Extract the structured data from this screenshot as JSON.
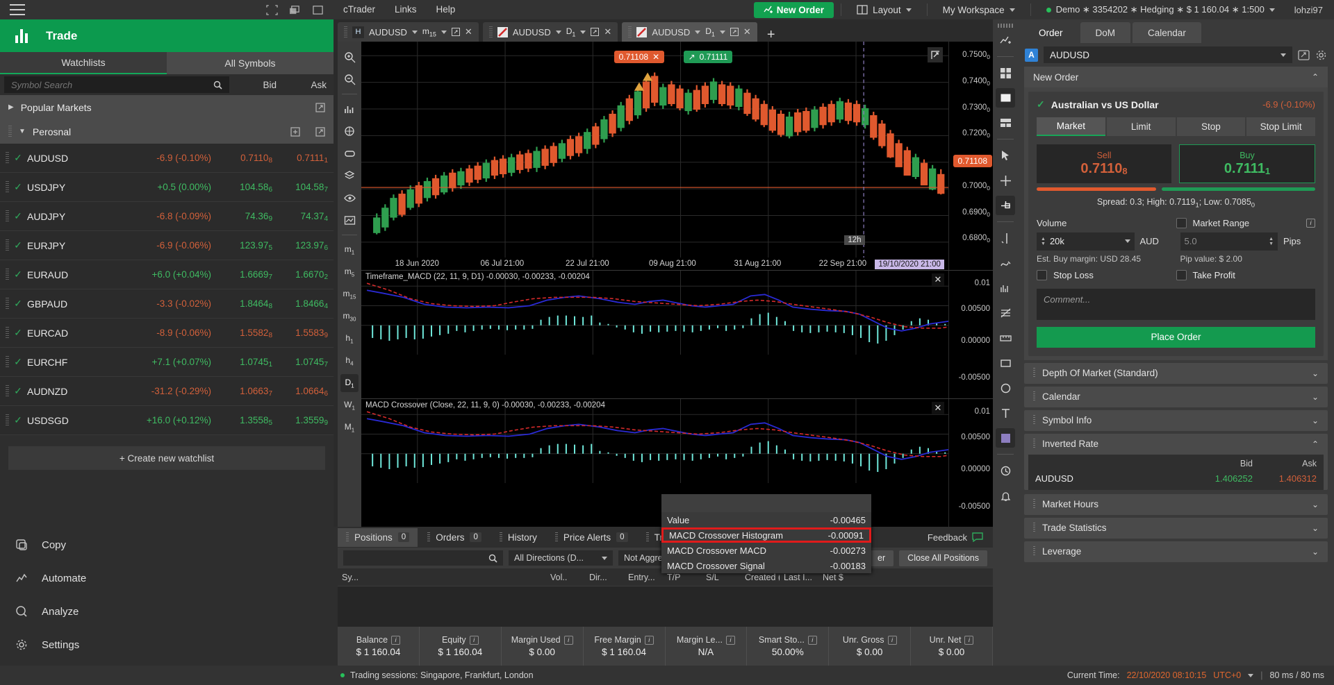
{
  "topbar": {
    "menus": [
      "cTrader",
      "Links",
      "Help"
    ],
    "new_order": "New Order",
    "layout": "Layout",
    "workspace": "My Workspace",
    "account": "Demo ∗ 3354202 ∗ Hedging ∗ $ 1 160.04 ∗ 1:500",
    "user": "lohzi97"
  },
  "sidebar": {
    "title": "Trade",
    "tabs": [
      {
        "label": "Watchlists",
        "active": true
      },
      {
        "label": "All Symbols",
        "active": false
      }
    ],
    "search_placeholder": "Symbol Search",
    "col_bid": "Bid",
    "col_ask": "Ask",
    "groups": [
      {
        "name": "Popular Markets",
        "expanded": false
      },
      {
        "name": "Perosnal",
        "expanded": true
      }
    ],
    "symbols": [
      {
        "name": "AUDUSD",
        "change": "-6.9 (-0.10%)",
        "dir": "down",
        "bid": "0.7110",
        "bid_sub": "8",
        "bid_dir": "down",
        "ask": "0.7111",
        "ask_sub": "1",
        "ask_dir": "down"
      },
      {
        "name": "USDJPY",
        "change": "+0.5 (0.00%)",
        "dir": "up",
        "bid": "104.58",
        "bid_sub": "6",
        "bid_dir": "up",
        "ask": "104.58",
        "ask_sub": "7",
        "ask_dir": "up"
      },
      {
        "name": "AUDJPY",
        "change": "-6.8 (-0.09%)",
        "dir": "down",
        "bid": "74.36",
        "bid_sub": "9",
        "bid_dir": "up",
        "ask": "74.37",
        "ask_sub": "4",
        "ask_dir": "up"
      },
      {
        "name": "EURJPY",
        "change": "-6.9 (-0.06%)",
        "dir": "down",
        "bid": "123.97",
        "bid_sub": "5",
        "bid_dir": "up",
        "ask": "123.97",
        "ask_sub": "6",
        "ask_dir": "up"
      },
      {
        "name": "EURAUD",
        "change": "+6.0 (+0.04%)",
        "dir": "up",
        "bid": "1.6669",
        "bid_sub": "7",
        "bid_dir": "up",
        "ask": "1.6670",
        "ask_sub": "2",
        "ask_dir": "up"
      },
      {
        "name": "GBPAUD",
        "change": "-3.3 (-0.02%)",
        "dir": "down",
        "bid": "1.8464",
        "bid_sub": "8",
        "bid_dir": "up",
        "ask": "1.8466",
        "ask_sub": "4",
        "ask_dir": "up"
      },
      {
        "name": "EURCAD",
        "change": "-8.9 (-0.06%)",
        "dir": "down",
        "bid": "1.5582",
        "bid_sub": "8",
        "bid_dir": "down",
        "ask": "1.5583",
        "ask_sub": "9",
        "ask_dir": "down"
      },
      {
        "name": "EURCHF",
        "change": "+7.1 (+0.07%)",
        "dir": "up",
        "bid": "1.0745",
        "bid_sub": "1",
        "bid_dir": "up",
        "ask": "1.0745",
        "ask_sub": "7",
        "ask_dir": "up"
      },
      {
        "name": "AUDNZD",
        "change": "-31.2 (-0.29%)",
        "dir": "down",
        "bid": "1.0663",
        "bid_sub": "7",
        "bid_dir": "down",
        "ask": "1.0664",
        "ask_sub": "6",
        "ask_dir": "down"
      },
      {
        "name": "USDSGD",
        "change": "+16.0 (+0.12%)",
        "dir": "up",
        "bid": "1.3558",
        "bid_sub": "5",
        "bid_dir": "up",
        "ask": "1.3559",
        "ask_sub": "9",
        "ask_dir": "up"
      }
    ],
    "create_watchlist": "+ Create new watchlist",
    "nav": [
      {
        "label": "Copy",
        "icon": "copy-icon"
      },
      {
        "label": "Automate",
        "icon": "automate-icon"
      },
      {
        "label": "Analyze",
        "icon": "analyze-icon"
      },
      {
        "label": "Settings",
        "icon": "gear-icon"
      }
    ]
  },
  "chart_tabs": [
    {
      "symbol": "AUDUSD",
      "tf": "m",
      "tf_sub": "15",
      "badge": "H",
      "active": false
    },
    {
      "symbol": "AUDUSD",
      "tf": "D",
      "tf_sub": "1",
      "badge": "line",
      "active": false
    },
    {
      "symbol": "AUDUSD",
      "tf": "D",
      "tf_sub": "1",
      "badge": "line",
      "active": true
    }
  ],
  "chart_data": {
    "type": "line",
    "title": "AUDUSD D1",
    "price_axis_ticks": [
      "0.7500",
      "0.7400",
      "0.7300",
      "0.7200",
      "0.7100",
      "0.7000",
      "0.6900",
      "0.6800"
    ],
    "price_axis_sub": [
      "0",
      "0",
      "0",
      "0",
      "8",
      "0",
      "0",
      "0"
    ],
    "x_ticks": [
      "18 Jun 2020",
      "06 Jul 21:00",
      "22 Jul 21:00",
      "09 Aug 21:00",
      "31 Aug 21:00",
      "22 Sep 21:00"
    ],
    "current_price_tag": "0.71108",
    "cursor_tag": "19/10/2020 21:00",
    "cursor_bar_label": "12h",
    "bid_tag": "0.71108",
    "ask_tag": "0.71111",
    "macd_panes": [
      {
        "label": "Timeframe_MACD (22, 11, 9, D1) -0.00030, -0.00233, -0.00204",
        "ticks": [
          "0.01",
          "0.00500",
          "0.00000",
          "-0.00500"
        ]
      },
      {
        "label": "MACD Crossover (Close, 22, 11, 9, 0) -0.00030, -0.00233, -0.00204",
        "ticks": [
          "0.01",
          "0.00500",
          "0.00000",
          "-0.00500"
        ]
      }
    ]
  },
  "tooltip": {
    "rows": [
      {
        "label": "Value",
        "value": "-0.00465",
        "highlight": false
      },
      {
        "label": "MACD Crossover Histogram",
        "value": "-0.00091",
        "highlight": true
      },
      {
        "label": "MACD Crossover MACD",
        "value": "-0.00273",
        "highlight": false
      },
      {
        "label": "MACD Crossover Signal",
        "value": "-0.00183",
        "highlight": false
      }
    ]
  },
  "bottom": {
    "tabs": [
      {
        "label": "Positions",
        "count": "0",
        "active": true
      },
      {
        "label": "Orders",
        "count": "0",
        "active": false
      },
      {
        "label": "History",
        "count": "",
        "active": false
      },
      {
        "label": "Price Alerts",
        "count": "0",
        "active": false
      },
      {
        "label": "Trans",
        "count": "",
        "active": false
      }
    ],
    "feedback": "Feedback",
    "filter_directions": "All Directions (D...",
    "filter_aggregation": "Not Aggreg",
    "btn_partial": "er",
    "btn_close_all": "Close All Positions",
    "columns": [
      "Sy...",
      "Vol..",
      "Dir...",
      "Entry...",
      "T/P",
      "S/L",
      "Created (...",
      "Last I...",
      "Net $"
    ]
  },
  "metrics": [
    {
      "label": "Balance",
      "value": "$ 1 160.04"
    },
    {
      "label": "Equity",
      "value": "$ 1 160.04"
    },
    {
      "label": "Margin Used",
      "value": "$ 0.00"
    },
    {
      "label": "Free Margin",
      "value": "$ 1 160.04"
    },
    {
      "label": "Margin Le...",
      "value": "N/A"
    },
    {
      "label": "Smart Sto...",
      "value": "50.00%"
    },
    {
      "label": "Unr. Gross",
      "value": "$ 0.00"
    },
    {
      "label": "Unr. Net",
      "value": "$ 0.00"
    }
  ],
  "right": {
    "tabs": [
      {
        "label": "Order",
        "active": true
      },
      {
        "label": "DoM",
        "active": false
      },
      {
        "label": "Calendar",
        "active": false
      }
    ],
    "symbol": "AUDUSD",
    "symbol_badge": "A",
    "new_order_header": "New Order",
    "instrument": "Australian vs US Dollar",
    "instrument_change": "-6.9 (-0.10%)",
    "order_types": [
      {
        "label": "Market",
        "active": true
      },
      {
        "label": "Limit",
        "active": false
      },
      {
        "label": "Stop",
        "active": false
      },
      {
        "label": "Stop Limit",
        "active": false
      }
    ],
    "sell_label": "Sell",
    "sell_price": "0.7110",
    "sell_price_sub": "8",
    "buy_label": "Buy",
    "buy_price": "0.7111",
    "buy_price_sub": "1",
    "spread_line": "Spread: 0.3; High: 0.7119",
    "spread_high_sub": "1",
    "spread_low_pre": "; Low: 0.7085",
    "spread_low_sub": "0",
    "volume_label": "Volume",
    "market_range_label": "Market Range",
    "volume_value": "20k",
    "volume_unit": "AUD",
    "pips_value": "5.0",
    "pips_unit": "Pips",
    "est_margin": "Est. Buy margin: USD 28.45",
    "pip_value": "Pip value: $ 2.00",
    "stop_loss": "Stop Loss",
    "take_profit": "Take Profit",
    "comment_placeholder": "Comment...",
    "place_order": "Place Order",
    "sections": [
      {
        "label": "Depth Of Market (Standard)",
        "expanded": false
      },
      {
        "label": "Calendar",
        "expanded": false
      },
      {
        "label": "Symbol Info",
        "expanded": false
      },
      {
        "label": "Inverted Rate",
        "expanded": true
      },
      {
        "label": "Market Hours",
        "expanded": false
      },
      {
        "label": "Trade Statistics",
        "expanded": false
      },
      {
        "label": "Leverage",
        "expanded": false
      }
    ],
    "inverted": {
      "col_bid": "Bid",
      "col_ask": "Ask",
      "symbol": "AUDUSD",
      "bid": "1.406252",
      "ask": "1.406312"
    }
  },
  "statusbar": {
    "sessions": "Trading sessions: Singapore, Frankfurt, London",
    "current_time_label": "Current Time:",
    "current_time": "22/10/2020 08:10:15",
    "timezone": "UTC+0",
    "ping": "80 ms / 80 ms"
  },
  "colors": {
    "green": "#0c9a4e",
    "up": "#3fbb62",
    "down": "#d2603a",
    "accent_red": "#e01b1b",
    "blue": "#2f82d6"
  }
}
